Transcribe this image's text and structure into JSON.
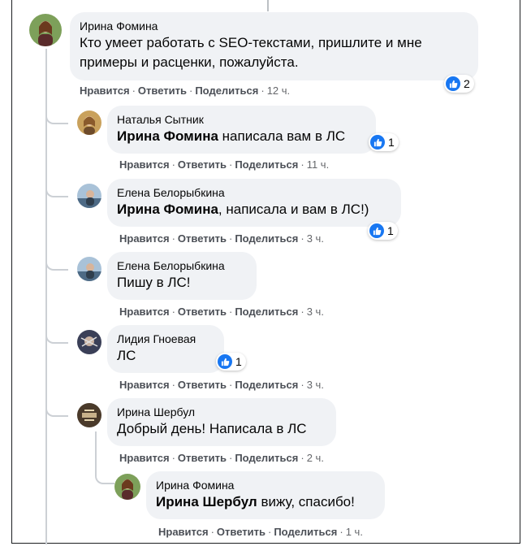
{
  "actions": {
    "like": "Нравится",
    "reply": "Ответить",
    "share": "Поделиться",
    "sep": "·"
  },
  "comments": [
    {
      "author": "Ирина Фомина",
      "mention": "",
      "text": "Кто умеет работать с SEO-текстами, пришлите и мне",
      "text2": "примеры и расценки, пожалуйста.",
      "time": "12 ч.",
      "likes": "2"
    },
    {
      "author": "Наталья Сытник",
      "mention": "Ирина Фомина",
      "text": " написала вам в ЛС",
      "time": "11 ч.",
      "likes": "1"
    },
    {
      "author": "Елена Белорыбкина",
      "mention": "Ирина Фомина",
      "text": ", написала и вам в ЛС!)",
      "time": "3 ч.",
      "likes": "1"
    },
    {
      "author": "Елена Белорыбкина",
      "mention": "",
      "text": "Пишу в ЛС!",
      "time": "3 ч.",
      "likes": ""
    },
    {
      "author": "Лидия Гноевая",
      "mention": "",
      "text": "ЛС",
      "time": "3 ч.",
      "likes": "1"
    },
    {
      "author": "Ирина Шербул",
      "mention": "",
      "text": "Добрый день! Написала в ЛС",
      "time": "2 ч.",
      "likes": ""
    },
    {
      "author": "Ирина Фомина",
      "mention": "Ирина Шербул",
      "text": " вижу, спасибо!",
      "time": "1 ч.",
      "likes": ""
    }
  ],
  "icons": {
    "like": "thumbs-up-icon"
  },
  "colors": {
    "like_blue": "#1877f2",
    "bubble": "#f0f2f5",
    "meta": "#65676b"
  }
}
